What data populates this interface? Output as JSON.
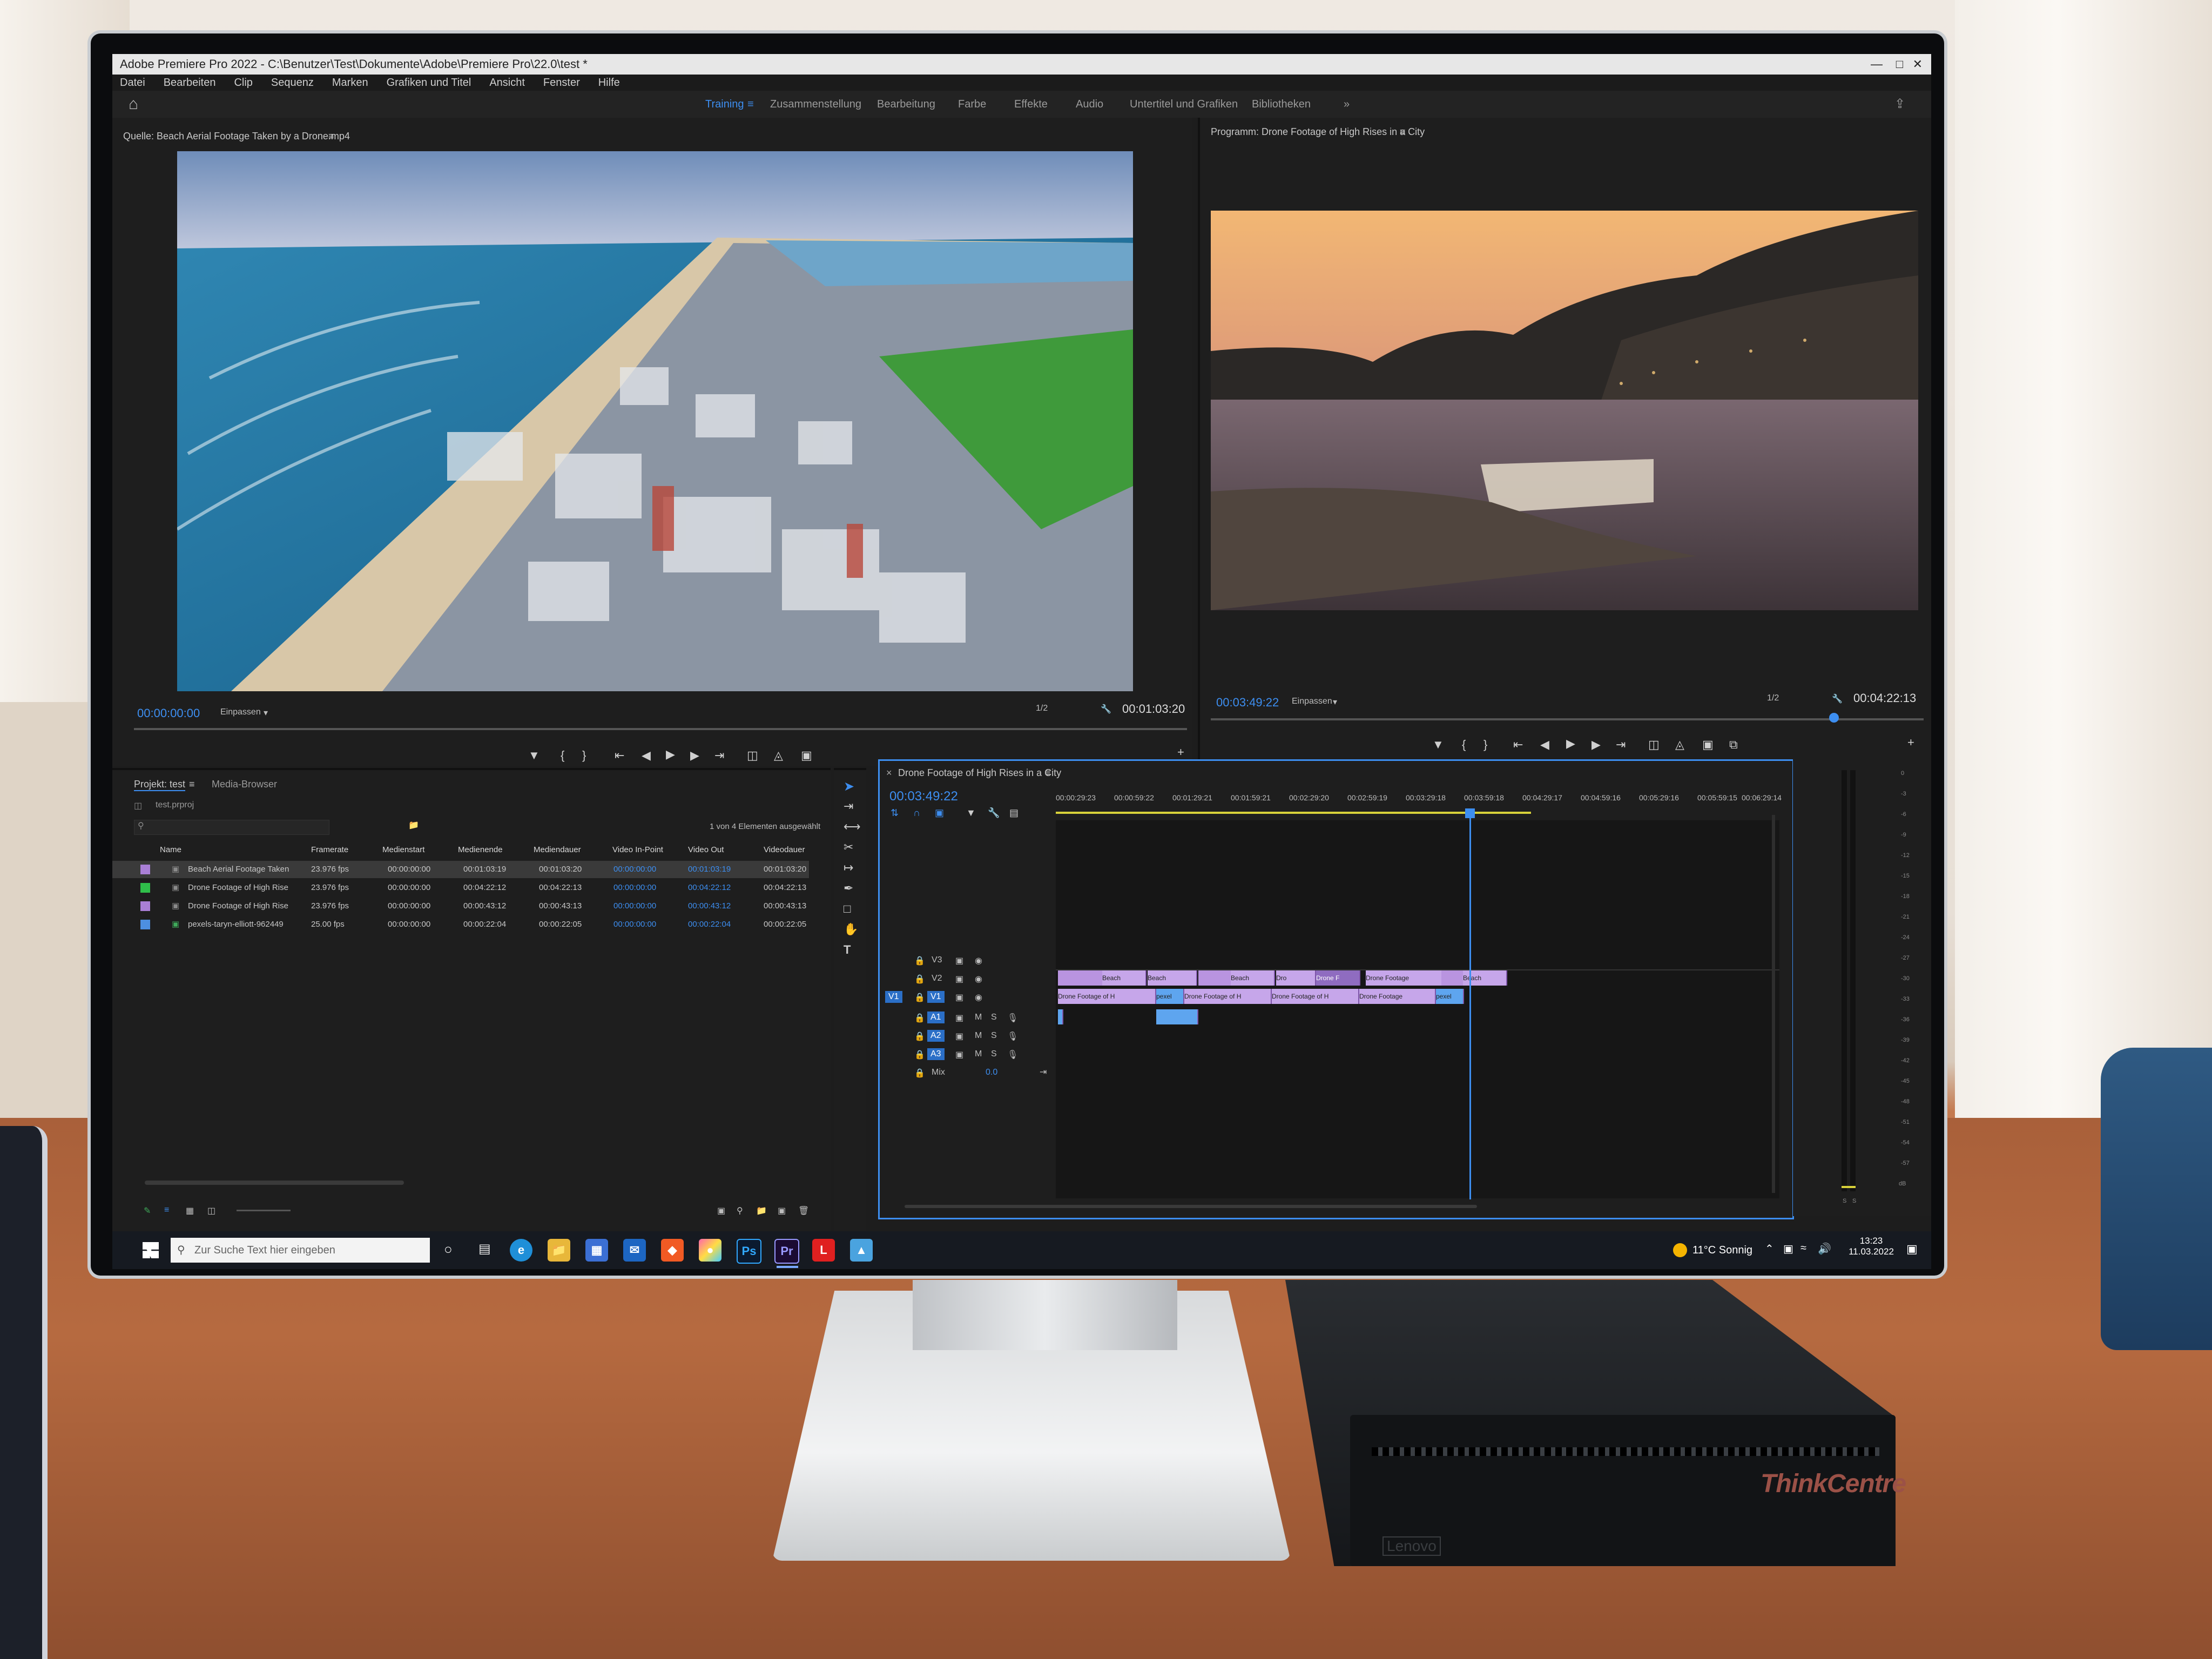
{
  "app": {
    "window_title": "Adobe Premiere Pro 2022 - C:\\Benutzer\\Test\\Dokumente\\Adobe\\Premiere Pro\\22.0\\test *",
    "menu": [
      "Datei",
      "Bearbeiten",
      "Clip",
      "Sequenz",
      "Marken",
      "Grafiken und Titel",
      "Ansicht",
      "Fenster",
      "Hilfe"
    ],
    "workspaces": [
      "Training",
      "Zusammenstellung",
      "Bearbeitung",
      "Farbe",
      "Effekte",
      "Audio",
      "Untertitel und Grafiken",
      "Bibliotheken"
    ],
    "active_workspace": "Training",
    "more": "»"
  },
  "source": {
    "title": "Quelle: Beach Aerial Footage Taken by a Drone.mp4",
    "timecode": "00:00:00:00",
    "fit": "Einpassen",
    "resolution": "1/2",
    "duration": "00:01:03:20"
  },
  "program": {
    "title": "Programm: Drone Footage of High Rises in a City",
    "timecode": "00:03:49:22",
    "fit": "Einpassen",
    "resolution": "1/2",
    "duration": "00:04:22:13"
  },
  "project": {
    "tab_project": "Projekt: test",
    "tab_media": "Media-Browser",
    "file": "test.prproj",
    "selection_info": "1 von 4 Elementen ausgewählt",
    "columns": [
      "Name",
      "Framerate",
      "Medienstart",
      "Medienende",
      "Mediendauer",
      "Video In-Point",
      "Video Out",
      "Videodauer"
    ],
    "rows": [
      {
        "color": "#a97fd6",
        "name": "Beach Aerial Footage Taken",
        "fps": "23.976 fps",
        "start": "00:00:00:00",
        "end": "00:01:03:19",
        "dur": "00:01:03:20",
        "in": "00:00:00:00",
        "out": "00:01:03:19",
        "vdur": "00:01:03:20"
      },
      {
        "color": "#2fbf4a",
        "name": "Drone Footage of High Rise",
        "fps": "23.976 fps",
        "start": "00:00:00:00",
        "end": "00:04:22:12",
        "dur": "00:04:22:13",
        "in": "00:00:00:00",
        "out": "00:04:22:12",
        "vdur": "00:04:22:13"
      },
      {
        "color": "#a97fd6",
        "name": "Drone Footage of High Rise",
        "fps": "23.976 fps",
        "start": "00:00:00:00",
        "end": "00:00:43:12",
        "dur": "00:00:43:13",
        "in": "00:00:00:00",
        "out": "00:00:43:12",
        "vdur": "00:00:43:13"
      },
      {
        "color": "#4d8fe0",
        "name": "pexels-taryn-elliott-962449",
        "fps": "25.00 fps",
        "start": "00:00:00:00",
        "end": "00:00:22:04",
        "dur": "00:00:22:05",
        "in": "00:00:00:00",
        "out": "00:00:22:04",
        "vdur": "00:00:22:05"
      }
    ]
  },
  "timeline": {
    "title": "Drone Footage of High Rises in a City",
    "timecode": "00:03:49:22",
    "ruler": [
      "00:00:29:23",
      "00:00:59:22",
      "00:01:29:21",
      "00:01:59:21",
      "00:02:29:20",
      "00:02:59:19",
      "00:03:29:18",
      "00:03:59:18",
      "00:04:29:17",
      "00:04:59:16",
      "00:05:29:16",
      "00:05:59:15",
      "00:06:29:14"
    ],
    "tracks_video": [
      "V3",
      "V2",
      "V1"
    ],
    "tracks_audio": [
      "A1",
      "A2",
      "A3"
    ],
    "mix_label": "Mix",
    "mix_value": "0.0",
    "v2_clips": [
      "Beach",
      "Beach",
      "Beach",
      "Dro",
      "Drone F",
      "Drone Footage",
      "Beach"
    ],
    "v1_clips": [
      "Drone Footage of H",
      "pexel",
      "Drone Footage of H",
      "Drone Footage of H",
      "Drone Footage",
      "pexel"
    ]
  },
  "meter": {
    "ticks": [
      "0",
      "-3",
      "-6",
      "-9",
      "-12",
      "-15",
      "-18",
      "-21",
      "-24",
      "-27",
      "-30",
      "-33",
      "-36",
      "-39",
      "-42",
      "-45",
      "-48",
      "-51",
      "-54",
      "-57",
      "dB"
    ],
    "labels": [
      "S",
      "S"
    ]
  },
  "taskbar": {
    "search_placeholder": "Zur Suche Text hier eingeben",
    "weather": "11°C Sonnig",
    "time": "13:23",
    "date": "11.03.2022",
    "apps": [
      "Ps",
      "Pr",
      "L"
    ]
  },
  "hardware": {
    "brand": "ThinkCentre",
    "maker": "Lenovo"
  }
}
